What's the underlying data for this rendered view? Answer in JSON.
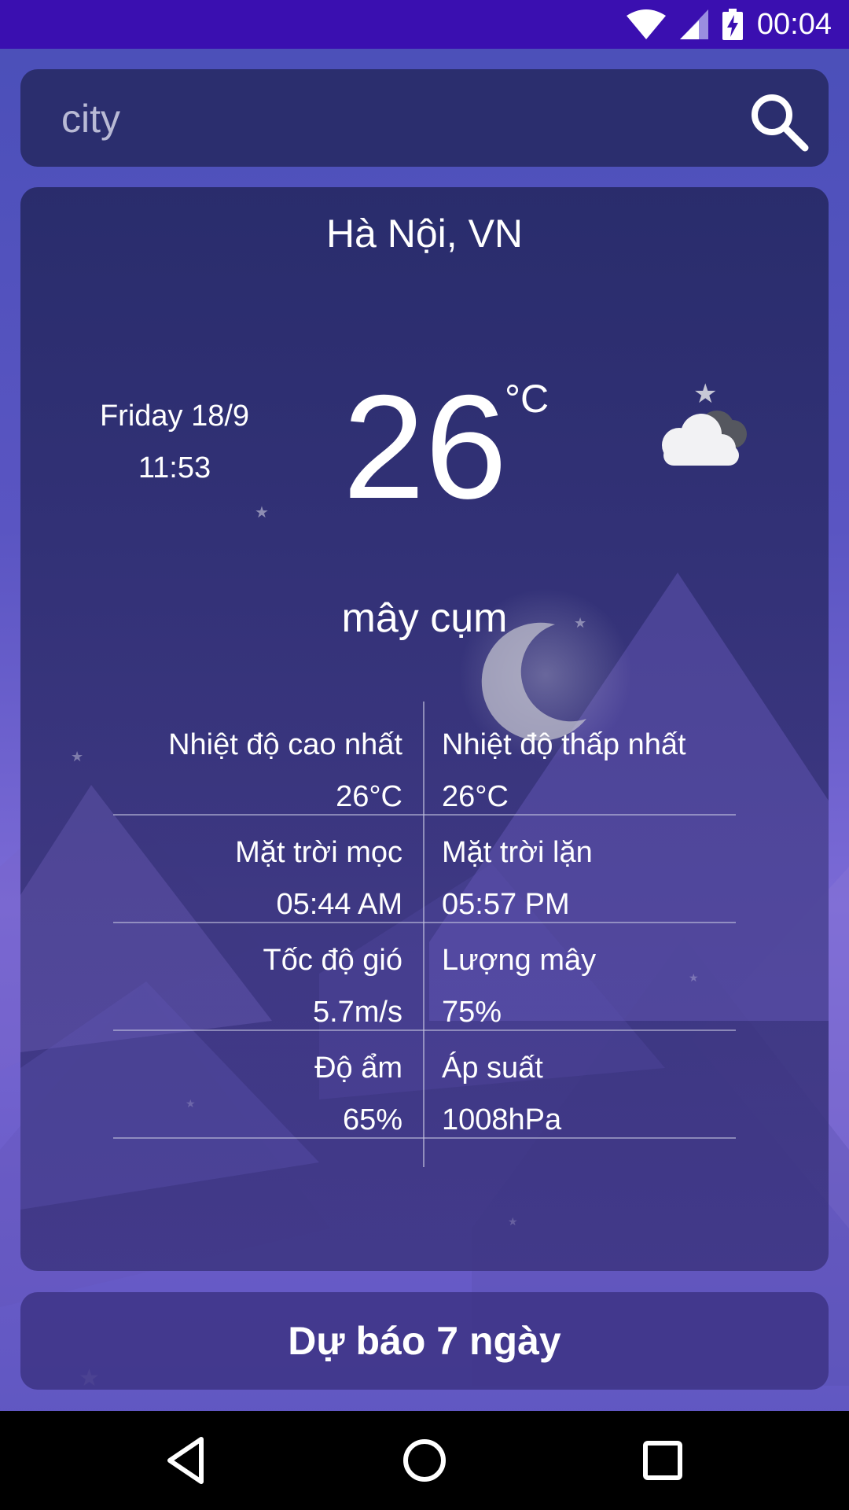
{
  "status_bar": {
    "time": "00:04"
  },
  "search": {
    "placeholder": "city"
  },
  "current": {
    "city": "Hà Nội, VN",
    "day": "Friday 18/9",
    "time": "11:53",
    "temperature": "26",
    "unit": "°C",
    "description": "mây cụm",
    "icon": "cloudy-night-icon"
  },
  "stats": [
    {
      "left_label": "Nhiệt độ cao nhất",
      "left_value": "26°C",
      "right_label": "Nhiệt độ thấp nhất",
      "right_value": "26°C"
    },
    {
      "left_label": "Mặt trời mọc",
      "left_value": "05:44 AM",
      "right_label": "Mặt trời lặn",
      "right_value": "05:57 PM"
    },
    {
      "left_label": "Tốc độ gió",
      "left_value": "5.7m/s",
      "right_label": "Lượng mây",
      "right_value": "75%"
    },
    {
      "left_label": "Độ ẩm",
      "left_value": "65%",
      "right_label": "Áp suất",
      "right_value": "1008hPa"
    }
  ],
  "forecast_button": {
    "label": "Dự báo 7 ngày"
  },
  "colors": {
    "status_bar": "#3a0fb0",
    "search_bg": "#2b2e6e",
    "card_bg": "#2c2f6e",
    "nav_bar": "#000000"
  }
}
